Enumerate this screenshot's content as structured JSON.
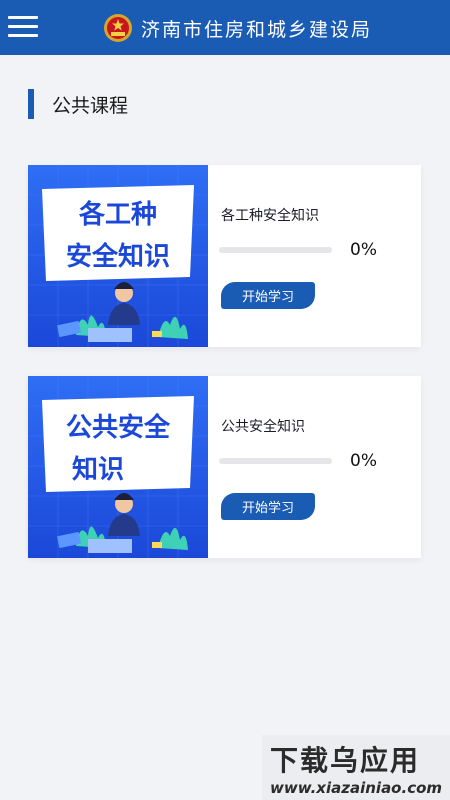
{
  "header": {
    "menu_icon": "hamburger-menu-icon",
    "emblem": "national-emblem",
    "title": "济南市住房和城乡建设局"
  },
  "section": {
    "title": "公共课程"
  },
  "courses": [
    {
      "thumbnail_text": [
        "各工种",
        "安全知识"
      ],
      "name": "各工种安全知识",
      "progress": 0,
      "progress_label": "0%",
      "button_label": "开始学习"
    },
    {
      "thumbnail_text": [
        "公共安全",
        "知识"
      ],
      "name": "公共安全知识",
      "progress": 0,
      "progress_label": "0%",
      "button_label": "开始学习"
    }
  ],
  "watermark": {
    "title": "下载乌应用",
    "url": "www.xiazainiao.com"
  },
  "colors": {
    "primary": "#1a5bb3",
    "background": "#f2f3f7"
  }
}
